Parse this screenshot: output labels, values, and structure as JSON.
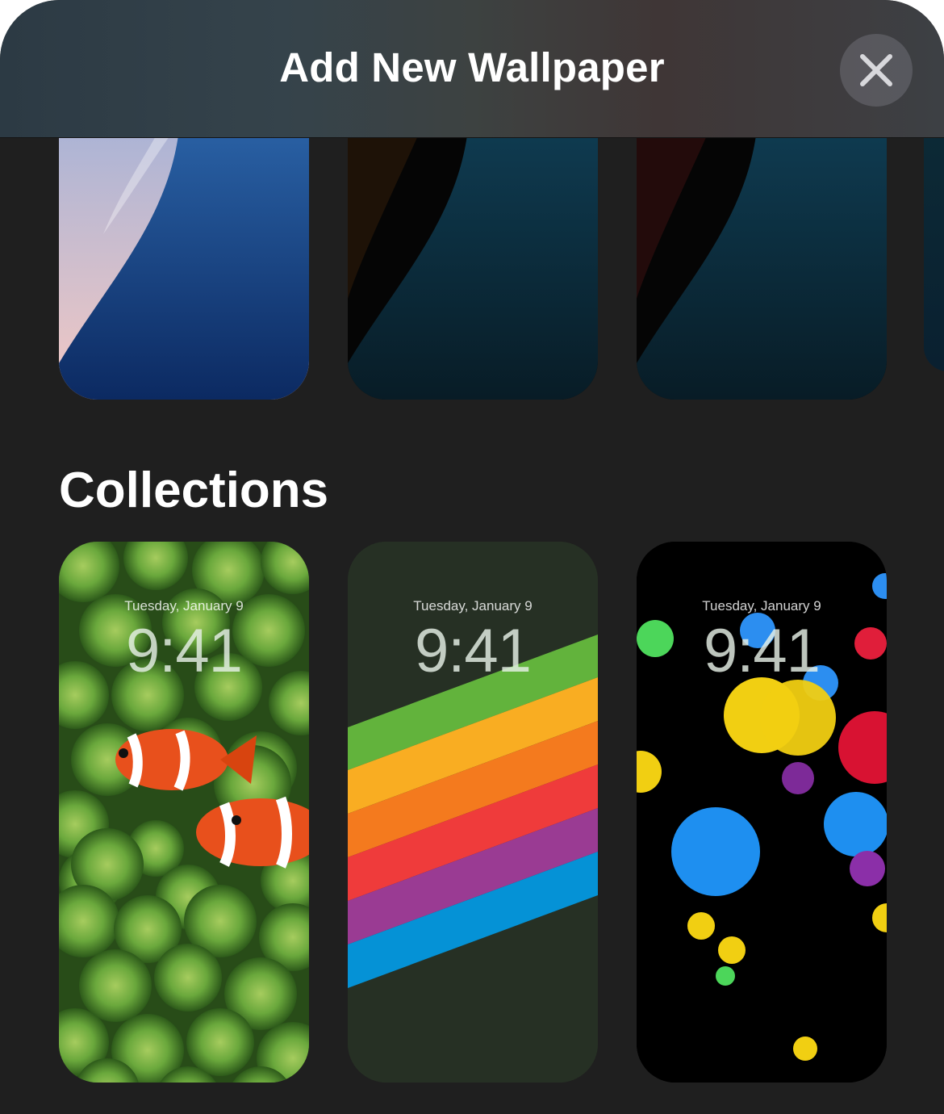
{
  "header": {
    "title": "Add New Wallpaper",
    "close_icon": "close-icon"
  },
  "featured": [
    {
      "name": "blue-pink-wave"
    },
    {
      "name": "dark-orange-wave"
    },
    {
      "name": "dark-red-wave"
    }
  ],
  "collections": {
    "title": "Collections",
    "items": [
      {
        "date": "Tuesday, January 9",
        "time": "9:41",
        "theme": "clownfish"
      },
      {
        "date": "Tuesday, January 9",
        "time": "9:41",
        "theme": "rainbow-stripes"
      },
      {
        "date": "Tuesday, January 9",
        "time": "9:41",
        "theme": "bubbles"
      }
    ]
  }
}
